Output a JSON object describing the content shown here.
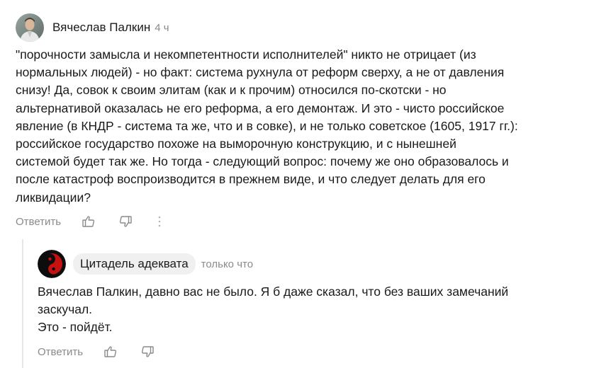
{
  "comments": [
    {
      "author": "Вячеслав Палкин",
      "time": "4 ч",
      "text": "\"порочности замысла и некомпетентности исполнителей\" никто не отрицает (из\nнормальных людей) - но факт: система рухнула от реформ сверху, а не от давления\nснизу! Да, совок к своим элитам (как и к прочим) относился по-скотски - но\nальтернативой оказалась не его реформа, а его демонтаж. И это - чисто российское\nявление (в КНДР - система та же, что и в совке), и не только советское (1605, 1917 гг.):\nроссийское государство похоже на выморочную конструкцию, и с нынешней\nсистемой будет так же. Но тогда - следующий вопрос: почему же оно образовалось и\nпосле катастроф воспроизводится в прежнем виде, и что следует делать для его\nликвидации?",
      "reply_label": "Ответить",
      "avatar_icon": "user-photo-icon",
      "like_icon": "thumb-up-icon",
      "dislike_icon": "thumb-down-icon",
      "more_icon": "more-vertical-icon"
    },
    {
      "author": "Цитадель адеквата",
      "time": "только что",
      "text": "Вячеслав Палкин, давно вас не было. Я б даже сказал, что без ваших замечаний\nзаскучал.\nЭто - пойдёт.",
      "reply_label": "Ответить",
      "avatar_icon": "yin-yang-icon",
      "like_icon": "thumb-up-icon",
      "dislike_icon": "thumb-down-icon"
    }
  ],
  "colors": {
    "text": "#1a1a1a",
    "muted": "#8a8a8a",
    "pill_bg": "#f0f0f0",
    "thread_line": "#e6e6e6"
  }
}
